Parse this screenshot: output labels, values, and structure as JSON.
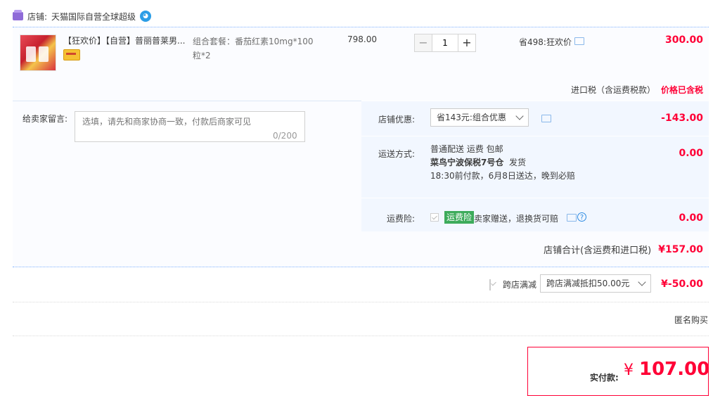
{
  "shop": {
    "label": "店铺:",
    "name": "天猫国际自营全球超级"
  },
  "item": {
    "title": "【狂欢价】【自营】普丽普莱男...",
    "sku_line1": "组合套餐：番茄红素10mg*100",
    "sku_line2": "粒*2",
    "price": "798.00",
    "quantity": "1",
    "minus": "−",
    "plus": "+",
    "promo": "省498:狂欢价",
    "total": "300.00"
  },
  "tax": {
    "label": "进口税（含运费税款）",
    "status": "价格已含税"
  },
  "memo": {
    "label": "给卖家留言:",
    "placeholder": "选填，请先和商家协商一致，付款后商家可见",
    "counter": "0/200"
  },
  "shop_discount": {
    "label": "店铺优惠:",
    "selected": "省143元:组合优惠",
    "amount": "-143.00"
  },
  "shipping": {
    "label": "运送方式:",
    "line1": "普通配送 运费 包邮",
    "warehouse": "菜鸟宁波保税7号仓",
    "ship_word": "发货",
    "line3": "18:30前付款，6月8日送达，晚到必赔",
    "amount": "0.00"
  },
  "insurance": {
    "label": "运费险:",
    "badge": "运费险",
    "desc": "卖家赠送，退换货可赔",
    "help": "?",
    "amount": "0.00"
  },
  "shop_total": {
    "label": "店铺合计(含运费和进口税)",
    "amount": "¥157.00"
  },
  "cross_store": {
    "label": "跨店满减",
    "selected": "跨店满减抵扣50.00元",
    "amount": "¥-50.00"
  },
  "anonymous": {
    "label": "匿名购买",
    "checked": true
  },
  "payment": {
    "label": "实付款:",
    "currency": "¥",
    "amount": "107.00"
  },
  "colors": {
    "accent_red": "#ff0036",
    "panel_blue": "#f2f7ff",
    "checkbox_blue": "#3b7be5",
    "insurance_green": "#3dab5b"
  }
}
